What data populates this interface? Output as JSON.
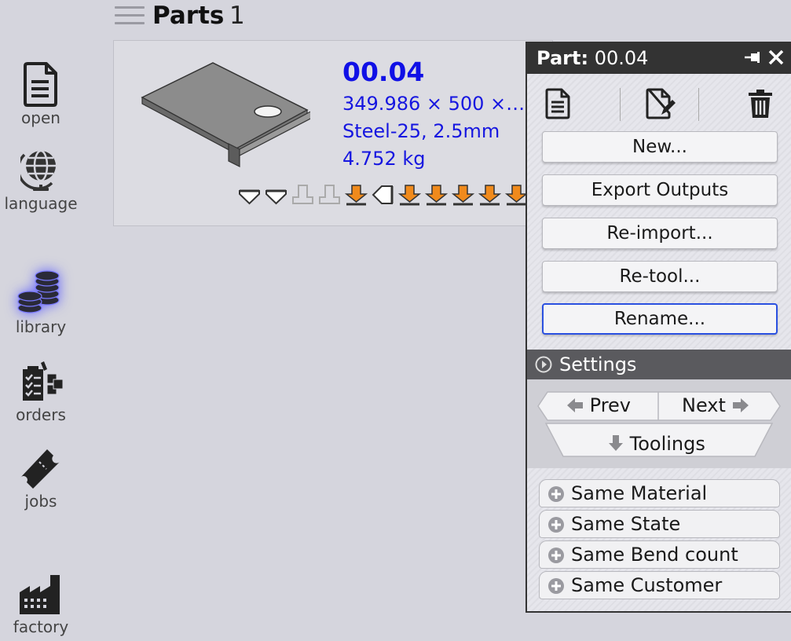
{
  "sidebar": {
    "items": [
      {
        "label": "open",
        "icon": "document-icon"
      },
      {
        "label": "language",
        "icon": "globe-icon"
      },
      {
        "label": "library",
        "icon": "coins-stack-icon",
        "active": true
      },
      {
        "label": "orders",
        "icon": "clipboard-boxes-icon"
      },
      {
        "label": "jobs",
        "icon": "ticket-icon"
      },
      {
        "label": "factory",
        "icon": "factory-icon"
      }
    ]
  },
  "header": {
    "title": "Parts",
    "count": "1"
  },
  "part_card": {
    "id": "00.04",
    "dimensions": "349.986 × 500 ×…",
    "material": "Steel-25, 2.5mm",
    "weight": "4.752 kg",
    "bend_icons": [
      "down-open",
      "down-open",
      "up-gray",
      "up-gray",
      "down-orange",
      "side-open",
      "down-orange",
      "down-orange",
      "down-orange",
      "down-orange",
      "down-orange"
    ]
  },
  "panel": {
    "title_prefix": "Part:",
    "title_value": "00.04",
    "actions": {
      "new": "New...",
      "export": "Export Outputs",
      "reimport": "Re-import...",
      "retool": "Re-tool...",
      "rename": "Rename..."
    },
    "settings_label": "Settings",
    "nav": {
      "prev": "Prev",
      "next": "Next",
      "toolings": "Toolings"
    },
    "filters": [
      "Same Material",
      "Same State",
      "Same Bend count",
      "Same Customer"
    ]
  },
  "colors": {
    "accent_blue": "#1616e0",
    "orange": "#f08a1c",
    "panel_header": "#333333",
    "settings_bar": "#5a5a5e",
    "focus_blue": "#2a50e0"
  }
}
